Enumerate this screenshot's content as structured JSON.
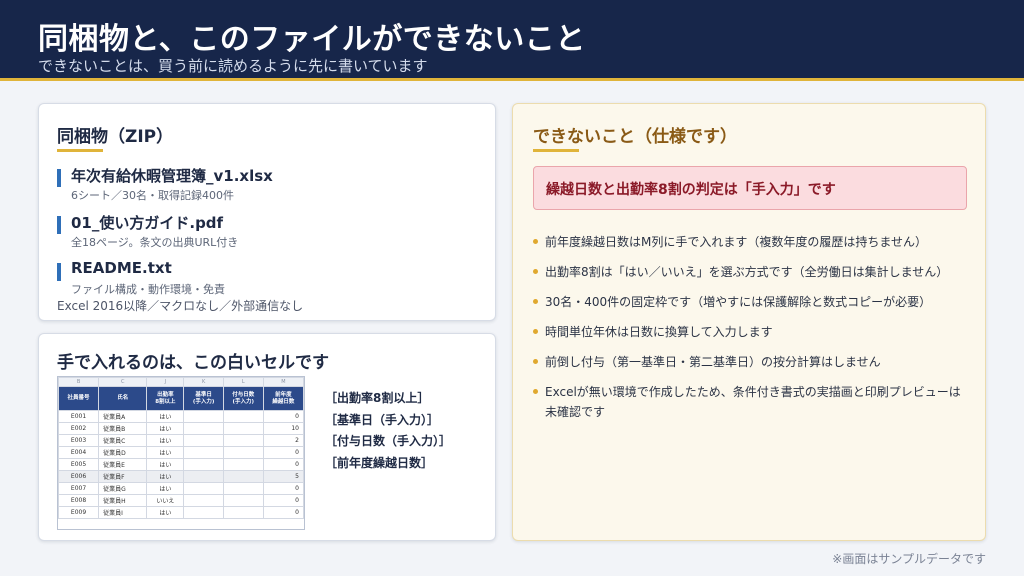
{
  "header": {
    "title": "同梱物と、このファイルができないこと",
    "subtitle": "できないことは、買う前に読めるように先に書いています"
  },
  "zip": {
    "heading": "同梱物（ZIP）",
    "files": [
      {
        "name": "年次有給休暇管理簿_v1.xlsx",
        "desc": "6シート／30名・取得記録400件"
      },
      {
        "name": "01_使い方ガイド.pdf",
        "desc": "全18ページ。条文の出典URL付き"
      },
      {
        "name": "README.txt",
        "desc": "ファイル構成・動作環境・免責"
      }
    ],
    "note": "Excel 2016以降／マクロなし／外部通信なし"
  },
  "input": {
    "heading": "手で入れるのは、この白いセルです",
    "labels": [
      "［出勤率8割以上］",
      "［基準日（手入力）］",
      "［付与日数（手入力）］",
      "［前年度繰越日数］"
    ],
    "sheet": {
      "col_letters": [
        "B",
        "C",
        "J",
        "K",
        "L",
        "M"
      ],
      "headers": [
        "社員番号",
        "氏名",
        "出勤率\n8割以上",
        "基準日\n(手入力)",
        "付与日数\n(手入力)",
        "前年度\n繰越日数"
      ],
      "rows": [
        [
          "E001",
          "従業員A",
          "はい",
          "",
          "",
          "0"
        ],
        [
          "E002",
          "従業員B",
          "はい",
          "",
          "",
          "10"
        ],
        [
          "E003",
          "従業員C",
          "はい",
          "",
          "",
          "2"
        ],
        [
          "E004",
          "従業員D",
          "はい",
          "",
          "",
          "0"
        ],
        [
          "E005",
          "従業員E",
          "はい",
          "",
          "",
          "0"
        ],
        [
          "E006",
          "従業員F",
          "はい",
          "",
          "",
          "5"
        ],
        [
          "E007",
          "従業員G",
          "はい",
          "",
          "",
          "0"
        ],
        [
          "E008",
          "従業員H",
          "いいえ",
          "",
          "",
          "0"
        ],
        [
          "E009",
          "従業員I",
          "はい",
          "",
          "",
          "0"
        ]
      ]
    }
  },
  "limits": {
    "heading": "できないこと（仕様です）",
    "callout": "繰越日数と出勤率8割の判定は「手入力」です",
    "items": [
      "前年度繰越日数はM列に手で入れます（複数年度の履歴は持ちません）",
      "出勤率8割は「はい／いいえ」を選ぶ方式です（全労働日は集計しません）",
      "30名・400件の固定枠です（増やすには保護解除と数式コピーが必要）",
      "時間単位年休は日数に換算して入力します",
      "前倒し付与（第一基準日・第二基準日）の按分計算はしません",
      "Excelが無い環境で作成したため、条件付き書式の実描画と印刷プレビューは未確認です"
    ]
  },
  "footnote": "※画面はサンプルデータです"
}
